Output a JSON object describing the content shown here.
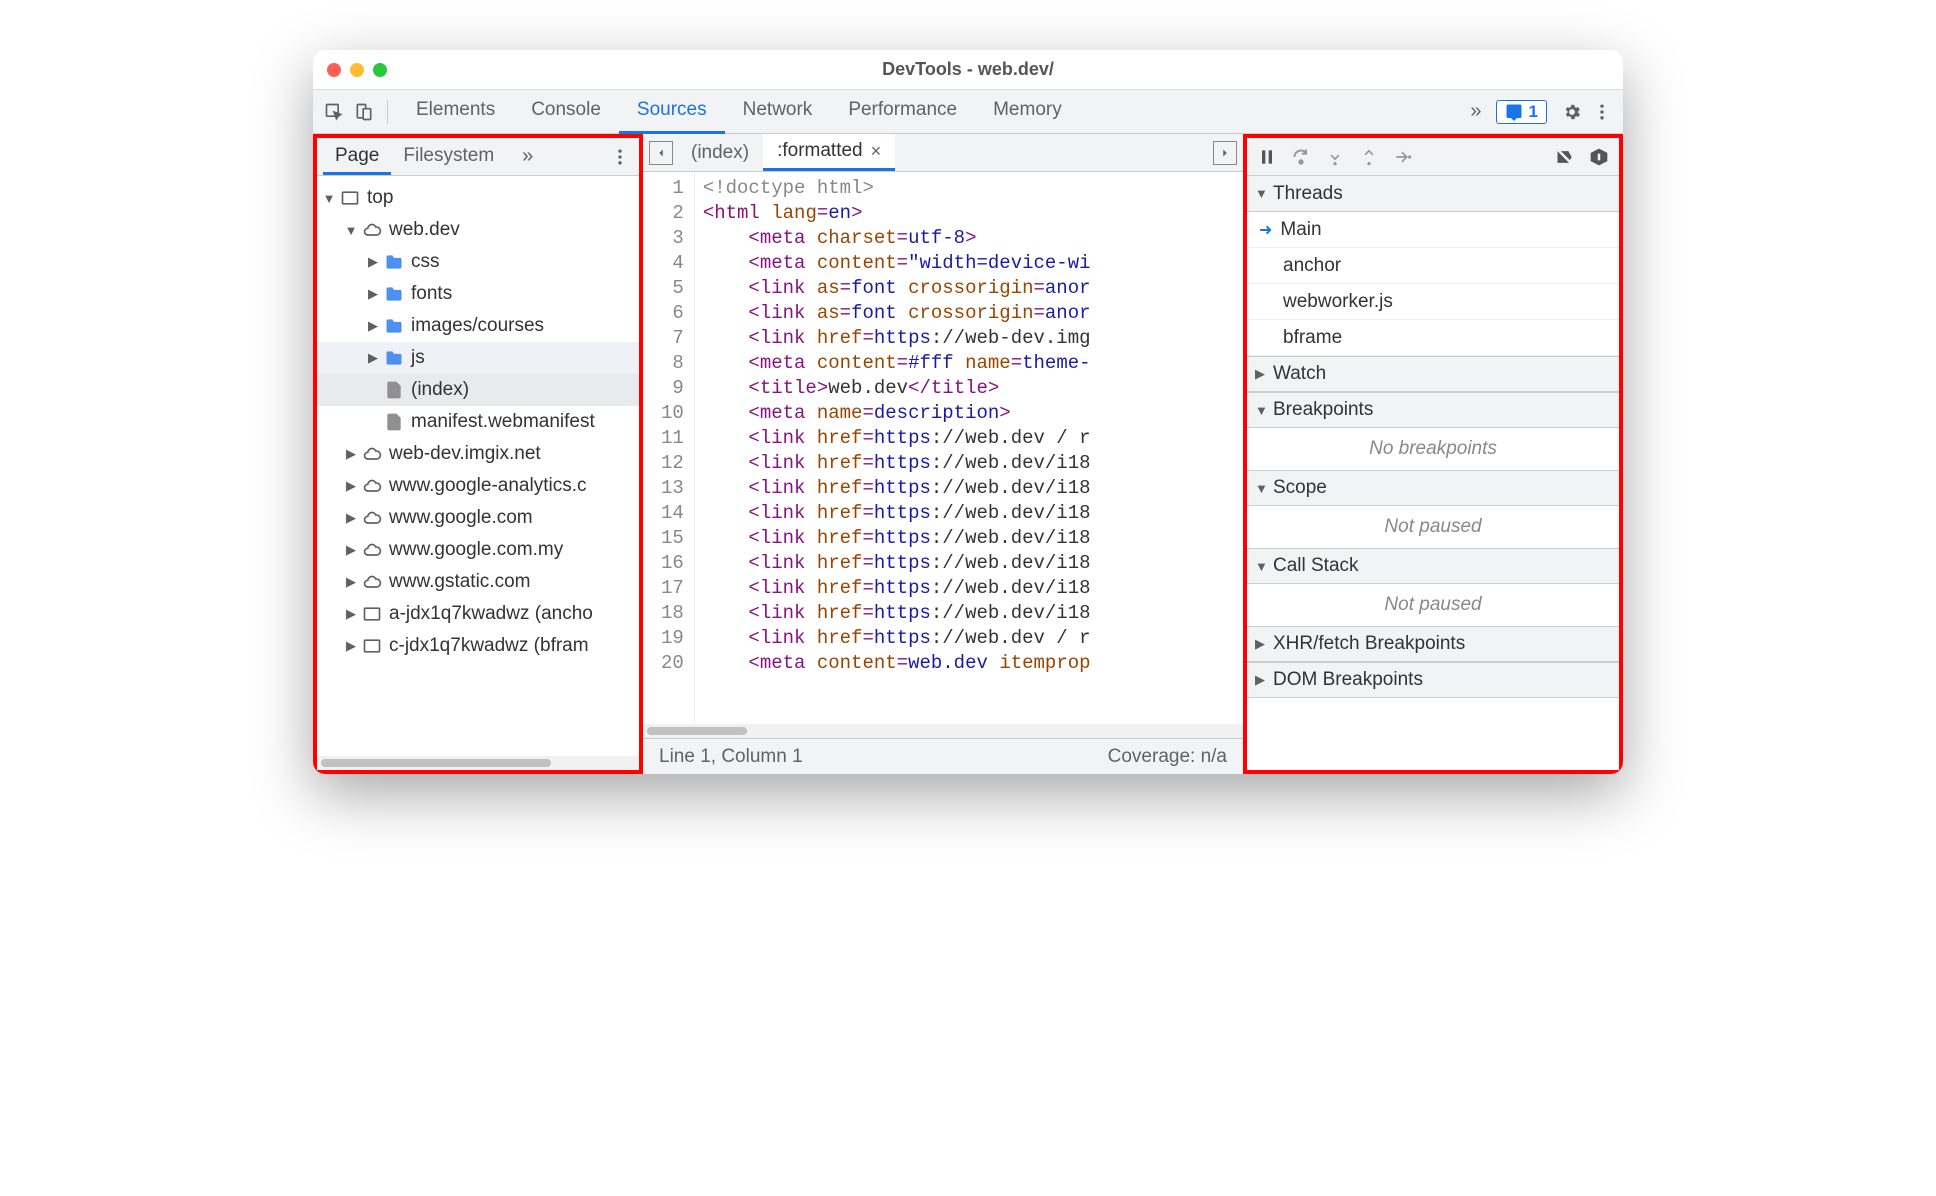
{
  "window": {
    "title": "DevTools - web.dev/"
  },
  "toolbar": {
    "tabs": [
      "Elements",
      "Console",
      "Sources",
      "Network",
      "Performance",
      "Memory"
    ],
    "active_tab": "Sources",
    "issue_count": "1"
  },
  "navigator": {
    "tabs": [
      "Page",
      "Filesystem"
    ],
    "active_tab": "Page",
    "tree": [
      {
        "label": "top",
        "icon": "frame",
        "depth": 0,
        "arrow": "open"
      },
      {
        "label": "web.dev",
        "icon": "cloud",
        "depth": 1,
        "arrow": "open"
      },
      {
        "label": "css",
        "icon": "folder",
        "depth": 2,
        "arrow": "closed"
      },
      {
        "label": "fonts",
        "icon": "folder",
        "depth": 2,
        "arrow": "closed"
      },
      {
        "label": "images/courses",
        "icon": "folder",
        "depth": 2,
        "arrow": "closed"
      },
      {
        "label": "js",
        "icon": "folder",
        "depth": 2,
        "arrow": "closed",
        "hover": true
      },
      {
        "label": "(index)",
        "icon": "file",
        "depth": 2,
        "selected": true
      },
      {
        "label": "manifest.webmanifest",
        "icon": "file",
        "depth": 2
      },
      {
        "label": "web-dev.imgix.net",
        "icon": "cloud",
        "depth": 1,
        "arrow": "closed"
      },
      {
        "label": "www.google-analytics.c",
        "icon": "cloud",
        "depth": 1,
        "arrow": "closed"
      },
      {
        "label": "www.google.com",
        "icon": "cloud",
        "depth": 1,
        "arrow": "closed"
      },
      {
        "label": "www.google.com.my",
        "icon": "cloud",
        "depth": 1,
        "arrow": "closed"
      },
      {
        "label": "www.gstatic.com",
        "icon": "cloud",
        "depth": 1,
        "arrow": "closed"
      },
      {
        "label": "a-jdx1q7kwadwz (ancho",
        "icon": "frame",
        "depth": 1,
        "arrow": "closed"
      },
      {
        "label": "c-jdx1q7kwadwz (bfram",
        "icon": "frame",
        "depth": 1,
        "arrow": "closed"
      }
    ]
  },
  "editor": {
    "tabs": [
      {
        "label": "(index)",
        "closable": false
      },
      {
        "label": ":formatted",
        "closable": true,
        "active": true
      }
    ],
    "code_lines": [
      [
        {
          "c": "t-doctype",
          "t": "<!doctype html>"
        }
      ],
      [
        {
          "c": "t-punc",
          "t": "<"
        },
        {
          "c": "t-tag",
          "t": "html"
        },
        {
          "c": "",
          "t": " "
        },
        {
          "c": "t-attr",
          "t": "lang"
        },
        {
          "c": "t-punc",
          "t": "="
        },
        {
          "c": "t-val",
          "t": "en"
        },
        {
          "c": "t-punc",
          "t": ">"
        }
      ],
      [
        {
          "c": "",
          "t": "    "
        },
        {
          "c": "t-punc",
          "t": "<"
        },
        {
          "c": "t-tag",
          "t": "meta"
        },
        {
          "c": "",
          "t": " "
        },
        {
          "c": "t-attr",
          "t": "charset"
        },
        {
          "c": "t-punc",
          "t": "="
        },
        {
          "c": "t-val",
          "t": "utf-8"
        },
        {
          "c": "t-punc",
          "t": ">"
        }
      ],
      [
        {
          "c": "",
          "t": "    "
        },
        {
          "c": "t-punc",
          "t": "<"
        },
        {
          "c": "t-tag",
          "t": "meta"
        },
        {
          "c": "",
          "t": " "
        },
        {
          "c": "t-attr",
          "t": "content"
        },
        {
          "c": "t-punc",
          "t": "="
        },
        {
          "c": "t-val",
          "t": "\"width=device-wi"
        }
      ],
      [
        {
          "c": "",
          "t": "    "
        },
        {
          "c": "t-punc",
          "t": "<"
        },
        {
          "c": "t-tag",
          "t": "link"
        },
        {
          "c": "",
          "t": " "
        },
        {
          "c": "t-attr",
          "t": "as"
        },
        {
          "c": "t-punc",
          "t": "="
        },
        {
          "c": "t-val",
          "t": "font"
        },
        {
          "c": "",
          "t": " "
        },
        {
          "c": "t-attr",
          "t": "crossorigin"
        },
        {
          "c": "t-punc",
          "t": "="
        },
        {
          "c": "t-val",
          "t": "anor"
        }
      ],
      [
        {
          "c": "",
          "t": "    "
        },
        {
          "c": "t-punc",
          "t": "<"
        },
        {
          "c": "t-tag",
          "t": "link"
        },
        {
          "c": "",
          "t": " "
        },
        {
          "c": "t-attr",
          "t": "as"
        },
        {
          "c": "t-punc",
          "t": "="
        },
        {
          "c": "t-val",
          "t": "font"
        },
        {
          "c": "",
          "t": " "
        },
        {
          "c": "t-attr",
          "t": "crossorigin"
        },
        {
          "c": "t-punc",
          "t": "="
        },
        {
          "c": "t-val",
          "t": "anor"
        }
      ],
      [
        {
          "c": "",
          "t": "    "
        },
        {
          "c": "t-punc",
          "t": "<"
        },
        {
          "c": "t-tag",
          "t": "link"
        },
        {
          "c": "",
          "t": " "
        },
        {
          "c": "t-attr",
          "t": "href"
        },
        {
          "c": "t-punc",
          "t": "="
        },
        {
          "c": "t-val",
          "t": "https"
        },
        {
          "c": "t-text",
          "t": "://web-dev.img"
        }
      ],
      [
        {
          "c": "",
          "t": "    "
        },
        {
          "c": "t-punc",
          "t": "<"
        },
        {
          "c": "t-tag",
          "t": "meta"
        },
        {
          "c": "",
          "t": " "
        },
        {
          "c": "t-attr",
          "t": "content"
        },
        {
          "c": "t-punc",
          "t": "="
        },
        {
          "c": "t-val",
          "t": "#fff"
        },
        {
          "c": "",
          "t": " "
        },
        {
          "c": "t-attr",
          "t": "name"
        },
        {
          "c": "t-punc",
          "t": "="
        },
        {
          "c": "t-val",
          "t": "theme-"
        }
      ],
      [
        {
          "c": "",
          "t": "    "
        },
        {
          "c": "t-punc",
          "t": "<"
        },
        {
          "c": "t-tag",
          "t": "title"
        },
        {
          "c": "t-punc",
          "t": ">"
        },
        {
          "c": "t-text",
          "t": "web.dev"
        },
        {
          "c": "t-punc",
          "t": "</"
        },
        {
          "c": "t-tag",
          "t": "title"
        },
        {
          "c": "t-punc",
          "t": ">"
        }
      ],
      [
        {
          "c": "",
          "t": "    "
        },
        {
          "c": "t-punc",
          "t": "<"
        },
        {
          "c": "t-tag",
          "t": "meta"
        },
        {
          "c": "",
          "t": " "
        },
        {
          "c": "t-attr",
          "t": "name"
        },
        {
          "c": "t-punc",
          "t": "="
        },
        {
          "c": "t-val",
          "t": "description"
        },
        {
          "c": "t-punc",
          "t": ">"
        }
      ],
      [
        {
          "c": "",
          "t": "    "
        },
        {
          "c": "t-punc",
          "t": "<"
        },
        {
          "c": "t-tag",
          "t": "link"
        },
        {
          "c": "",
          "t": " "
        },
        {
          "c": "t-attr",
          "t": "href"
        },
        {
          "c": "t-punc",
          "t": "="
        },
        {
          "c": "t-val",
          "t": "https"
        },
        {
          "c": "t-text",
          "t": "://web.dev / r"
        }
      ],
      [
        {
          "c": "",
          "t": "    "
        },
        {
          "c": "t-punc",
          "t": "<"
        },
        {
          "c": "t-tag",
          "t": "link"
        },
        {
          "c": "",
          "t": " "
        },
        {
          "c": "t-attr",
          "t": "href"
        },
        {
          "c": "t-punc",
          "t": "="
        },
        {
          "c": "t-val",
          "t": "https"
        },
        {
          "c": "t-text",
          "t": "://web.dev/i18"
        }
      ],
      [
        {
          "c": "",
          "t": "    "
        },
        {
          "c": "t-punc",
          "t": "<"
        },
        {
          "c": "t-tag",
          "t": "link"
        },
        {
          "c": "",
          "t": " "
        },
        {
          "c": "t-attr",
          "t": "href"
        },
        {
          "c": "t-punc",
          "t": "="
        },
        {
          "c": "t-val",
          "t": "https"
        },
        {
          "c": "t-text",
          "t": "://web.dev/i18"
        }
      ],
      [
        {
          "c": "",
          "t": "    "
        },
        {
          "c": "t-punc",
          "t": "<"
        },
        {
          "c": "t-tag",
          "t": "link"
        },
        {
          "c": "",
          "t": " "
        },
        {
          "c": "t-attr",
          "t": "href"
        },
        {
          "c": "t-punc",
          "t": "="
        },
        {
          "c": "t-val",
          "t": "https"
        },
        {
          "c": "t-text",
          "t": "://web.dev/i18"
        }
      ],
      [
        {
          "c": "",
          "t": "    "
        },
        {
          "c": "t-punc",
          "t": "<"
        },
        {
          "c": "t-tag",
          "t": "link"
        },
        {
          "c": "",
          "t": " "
        },
        {
          "c": "t-attr",
          "t": "href"
        },
        {
          "c": "t-punc",
          "t": "="
        },
        {
          "c": "t-val",
          "t": "https"
        },
        {
          "c": "t-text",
          "t": "://web.dev/i18"
        }
      ],
      [
        {
          "c": "",
          "t": "    "
        },
        {
          "c": "t-punc",
          "t": "<"
        },
        {
          "c": "t-tag",
          "t": "link"
        },
        {
          "c": "",
          "t": " "
        },
        {
          "c": "t-attr",
          "t": "href"
        },
        {
          "c": "t-punc",
          "t": "="
        },
        {
          "c": "t-val",
          "t": "https"
        },
        {
          "c": "t-text",
          "t": "://web.dev/i18"
        }
      ],
      [
        {
          "c": "",
          "t": "    "
        },
        {
          "c": "t-punc",
          "t": "<"
        },
        {
          "c": "t-tag",
          "t": "link"
        },
        {
          "c": "",
          "t": " "
        },
        {
          "c": "t-attr",
          "t": "href"
        },
        {
          "c": "t-punc",
          "t": "="
        },
        {
          "c": "t-val",
          "t": "https"
        },
        {
          "c": "t-text",
          "t": "://web.dev/i18"
        }
      ],
      [
        {
          "c": "",
          "t": "    "
        },
        {
          "c": "t-punc",
          "t": "<"
        },
        {
          "c": "t-tag",
          "t": "link"
        },
        {
          "c": "",
          "t": " "
        },
        {
          "c": "t-attr",
          "t": "href"
        },
        {
          "c": "t-punc",
          "t": "="
        },
        {
          "c": "t-val",
          "t": "https"
        },
        {
          "c": "t-text",
          "t": "://web.dev/i18"
        }
      ],
      [
        {
          "c": "",
          "t": "    "
        },
        {
          "c": "t-punc",
          "t": "<"
        },
        {
          "c": "t-tag",
          "t": "link"
        },
        {
          "c": "",
          "t": " "
        },
        {
          "c": "t-attr",
          "t": "href"
        },
        {
          "c": "t-punc",
          "t": "="
        },
        {
          "c": "t-val",
          "t": "https"
        },
        {
          "c": "t-text",
          "t": "://web.dev / r"
        }
      ],
      [
        {
          "c": "",
          "t": "    "
        },
        {
          "c": "t-punc",
          "t": "<"
        },
        {
          "c": "t-tag",
          "t": "meta"
        },
        {
          "c": "",
          "t": " "
        },
        {
          "c": "t-attr",
          "t": "content"
        },
        {
          "c": "t-punc",
          "t": "="
        },
        {
          "c": "t-val",
          "t": "web.dev"
        },
        {
          "c": "",
          "t": " "
        },
        {
          "c": "t-attr",
          "t": "itemprop"
        }
      ]
    ],
    "status_left": "Line 1, Column 1",
    "status_right": "Coverage: n/a"
  },
  "debugger": {
    "sections": [
      {
        "title": "Threads",
        "open": true,
        "type": "threads",
        "items": [
          "Main",
          "anchor",
          "webworker.js",
          "bframe"
        ],
        "current": "Main"
      },
      {
        "title": "Watch",
        "open": false
      },
      {
        "title": "Breakpoints",
        "open": true,
        "msg": "No breakpoints"
      },
      {
        "title": "Scope",
        "open": true,
        "msg": "Not paused"
      },
      {
        "title": "Call Stack",
        "open": true,
        "msg": "Not paused"
      },
      {
        "title": "XHR/fetch Breakpoints",
        "open": false
      },
      {
        "title": "DOM Breakpoints",
        "open": false
      }
    ]
  }
}
